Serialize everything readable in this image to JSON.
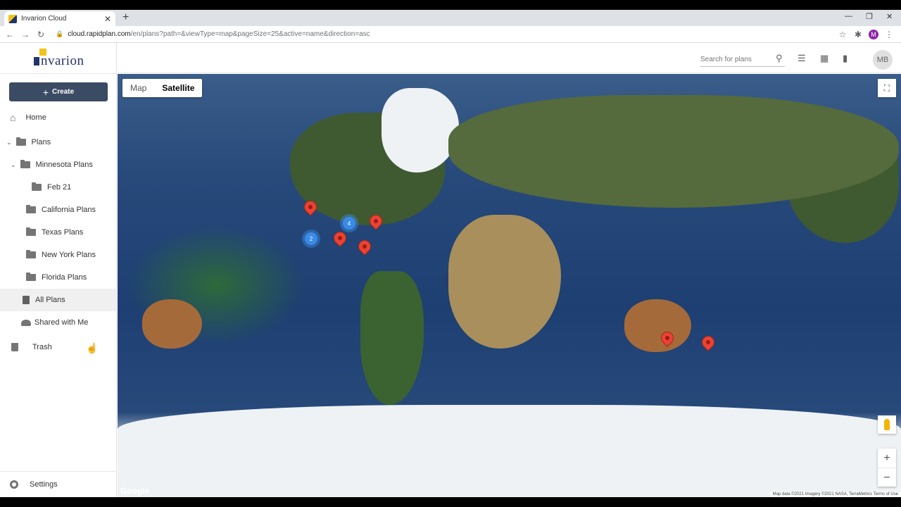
{
  "browser": {
    "tab_title": "Invarion Cloud",
    "url_host": "cloud.rapidplan.com",
    "url_path": "/en/plans?path=&viewType=map&pageSize=25&active=name&direction=asc",
    "profile_initial": "M"
  },
  "app": {
    "logo_text": "nvarion",
    "create_label": "Create"
  },
  "sidebar": {
    "home": "Home",
    "plans": "Plans",
    "minnesota": "Minnesota Plans",
    "feb21": "Feb 21",
    "california": "California Plans",
    "texas": "Texas Plans",
    "newyork": "New York Plans",
    "florida": "Florida Plans",
    "all_plans": "All Plans",
    "shared": "Shared with Me",
    "trash": "Trash",
    "settings": "Settings"
  },
  "header": {
    "search_placeholder": "Search for plans",
    "avatar": "MB"
  },
  "map": {
    "type_map": "Map",
    "type_satellite": "Satellite",
    "selected_type": "Satellite",
    "cluster_1": "4",
    "cluster_2": "2",
    "google": "Google",
    "attribution": "Map data ©2021 Imagery ©2021 NASA, TerraMetrics    Terms of Use"
  }
}
